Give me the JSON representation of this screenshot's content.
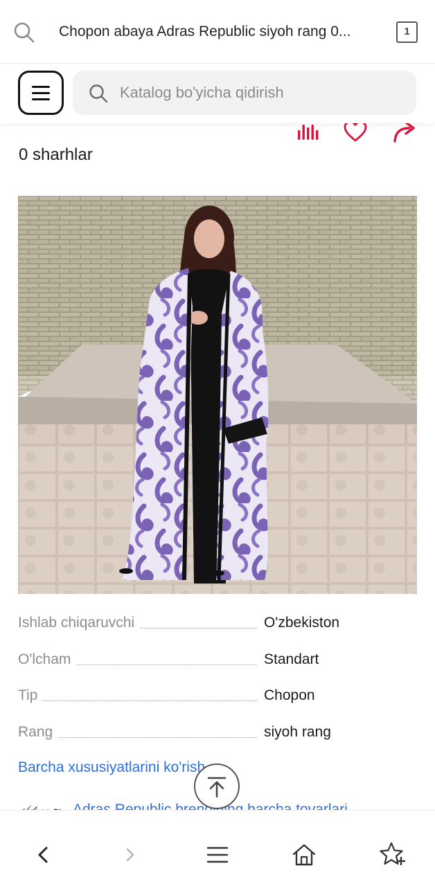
{
  "browser": {
    "url_text": "Chopon abaya Adras Republic siyoh rang 0...",
    "tab_count": "1"
  },
  "header": {
    "search_placeholder": "Katalog bo'yicha qidirish"
  },
  "icons": {
    "compare": "bar-chart-icon",
    "favorite": "heart-icon",
    "share": "share-arrow-icon"
  },
  "colors": {
    "accent": "#d8143c",
    "link": "#2f6fd6"
  },
  "product": {
    "reviews_label": "0 sharhlar",
    "specs": [
      {
        "key": "Ishlab chiqaruvchi",
        "value": "O'zbekiston"
      },
      {
        "key": "O'lcham",
        "value": "Standart"
      },
      {
        "key": "Tip",
        "value": "Chopon"
      },
      {
        "key": "Rang",
        "value": "siyoh rang"
      }
    ],
    "all_specs_link": "Barcha xususiyatlarini ko'rish",
    "brand_link": "Adras Republic brendining barcha tovarlari"
  }
}
